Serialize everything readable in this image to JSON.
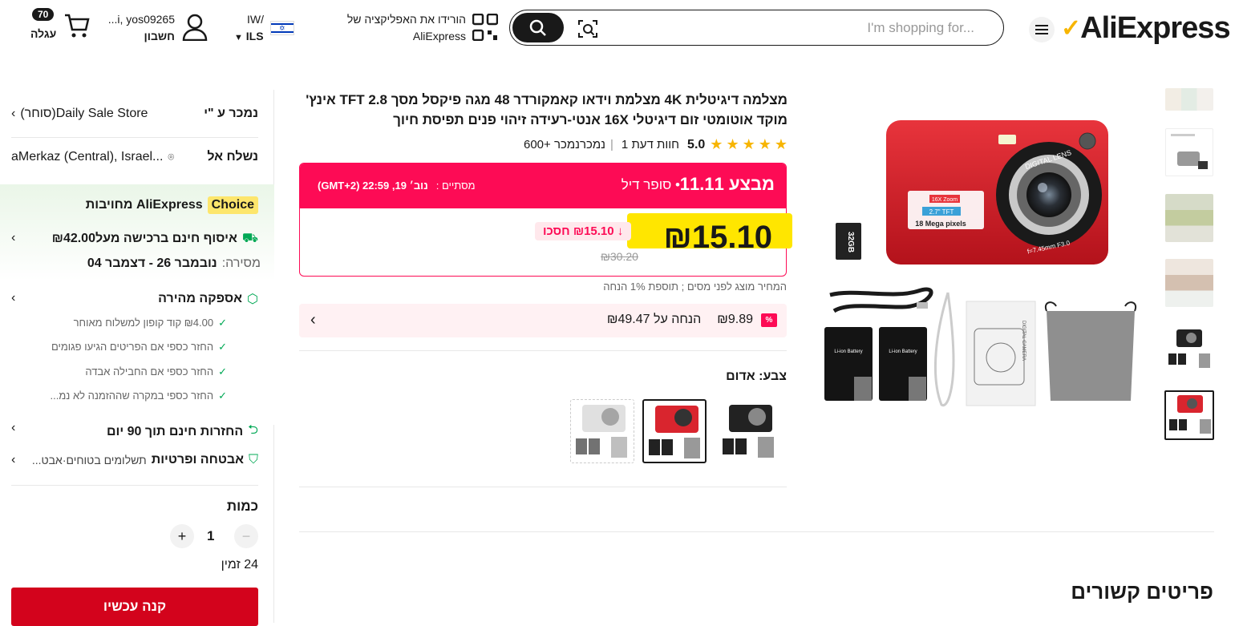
{
  "header": {
    "logo": "AliExpress",
    "search_placeholder": "I'm shopping for...",
    "app_line1": "הורידו את האפליקציה של",
    "app_line2": "AliExpress",
    "lang": "IW/",
    "currency": "ILS",
    "account_user": "...i, yos09265",
    "account_label": "חשבון",
    "cart_count": "70",
    "cart_label": "עגלה"
  },
  "product": {
    "title": "מצלמה דיגיטלית 4K מצלמת וידאו קאמקורדר 48 מגה פיקסל מסך TFT 2.8 אינץ' מוקד אוטומטי זום דיגיטלי 16X אנטי-רעידה זיהוי פנים תפיסת חיוך",
    "rating": "5.0",
    "reviews": "1 חוות דעת",
    "sold": "600+ נמכרנמכר",
    "deal_brand": "מבצע 11.11",
    "deal_type": "סופר דיל",
    "deal_ends_label": "מסתיים :",
    "deal_ends": "נוב׳ 19, 22:59 (GMT+2)",
    "price": "₪15.10",
    "save": "₪15.10 חסכו",
    "orig_price": "₪30.20",
    "tax_note": "המחיר מוצג לפני מסים ; תוספת 1% הנחה",
    "coupon_value": "₪9.89",
    "coupon_text": "הנחה על ₪49.47",
    "color_label": "צבע: אדום"
  },
  "gallery": {
    "card_brand": "DIGITAL LENS",
    "card_zoom": "16X Zoom",
    "card_tft": "2.7\" TFT",
    "card_mp": "18 Mega pixels",
    "card_lens": "f=7.45mm F3.0",
    "sd_card": "32GB",
    "battery": "Li-ion Battery",
    "box_label": "DIGITAL CAMERA"
  },
  "panel": {
    "sold_by_label": "נמכר ע \"י",
    "store": "Daily Sale Store(סוחר)",
    "ship_to_label": "נשלח אל",
    "ship_to": "aMerkaz (Central), Israel...",
    "choice_badge": "Choice",
    "choice_text": "AliExpress מחויבות",
    "free_shipping": "איסוף חינם ברכישה מעל₪42.00",
    "delivery_label": "מסירה:",
    "delivery": "נובמבר 26 - דצמבר 04",
    "fast_delivery": "אספקה מהירה",
    "bullet1": "₪4.00 קוד קופון למשלוח מאוחר",
    "bullet2": "החזר כספי אם הפריטים הגיעו פגומים",
    "bullet3": "החזר כספי אם החבילה אבדה",
    "bullet4": "החזר כספי במקרה שההזמנה לא נמ...",
    "returns": "החזרות חינם תוך 90 יום",
    "security": "אבטחה ופרטיות",
    "security_sub": "תשלומים בטוחים·אבט...",
    "qty_label": "כמות",
    "qty": "1",
    "available": "24 זמין",
    "buy_now": "קנה עכשיו"
  },
  "related_title": "פריטים קשורים",
  "colors": {
    "accent": "#fd0b55",
    "buy": "#d3031c",
    "highlight": "#ffe600",
    "choice": "#fde66c"
  }
}
